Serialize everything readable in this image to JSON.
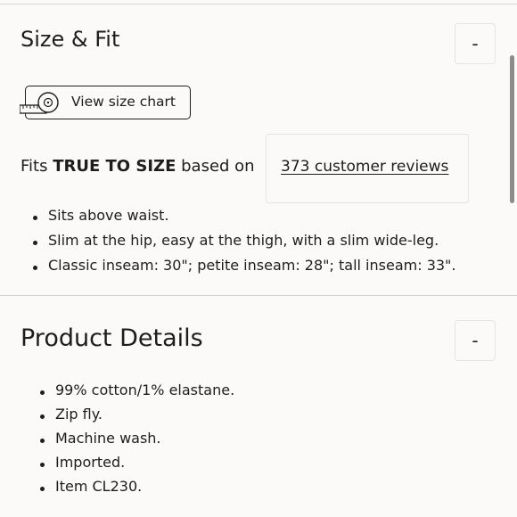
{
  "size_fit": {
    "title": "Size & Fit",
    "toggle_label": "-",
    "size_chart_button": "View size chart",
    "fits_prefix": "Fits ",
    "fits_emphasis": "TRUE TO SIZE",
    "fits_suffix": " based on",
    "reviews_link": "373 customer reviews",
    "bullets": [
      "Sits above waist.",
      "Slim at the hip, easy at the thigh, with a slim wide-leg.",
      "Classic inseam: 30\"; petite inseam: 28\"; tall inseam: 33\"."
    ],
    "icons": {
      "size_chart": "measuring-tape-icon"
    }
  },
  "product_details": {
    "title": "Product Details",
    "toggle_label": "-",
    "bullets": [
      "99% cotton/1% elastane.",
      "Zip fly.",
      "Machine wash.",
      "Imported.",
      "Item CL230."
    ]
  }
}
